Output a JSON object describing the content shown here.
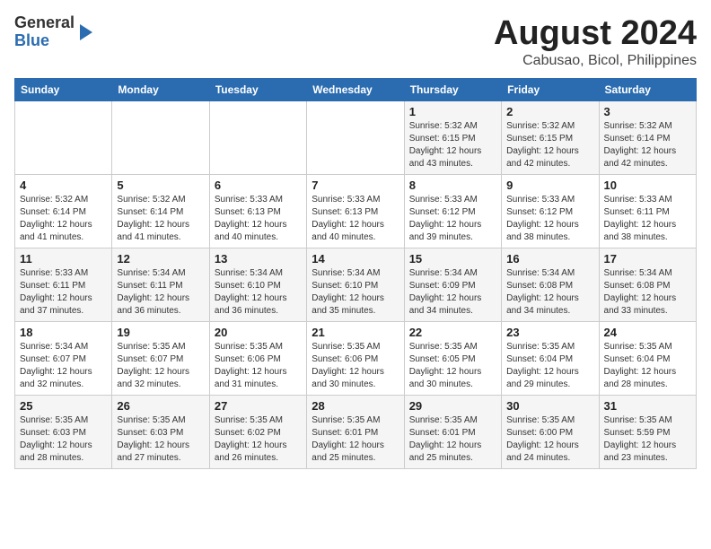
{
  "logo": {
    "general": "General",
    "blue": "Blue"
  },
  "title": "August 2024",
  "subtitle": "Cabusao, Bicol, Philippines",
  "days_of_week": [
    "Sunday",
    "Monday",
    "Tuesday",
    "Wednesday",
    "Thursday",
    "Friday",
    "Saturday"
  ],
  "weeks": [
    [
      {
        "day": "",
        "info": ""
      },
      {
        "day": "",
        "info": ""
      },
      {
        "day": "",
        "info": ""
      },
      {
        "day": "",
        "info": ""
      },
      {
        "day": "1",
        "info": "Sunrise: 5:32 AM\nSunset: 6:15 PM\nDaylight: 12 hours\nand 43 minutes."
      },
      {
        "day": "2",
        "info": "Sunrise: 5:32 AM\nSunset: 6:15 PM\nDaylight: 12 hours\nand 42 minutes."
      },
      {
        "day": "3",
        "info": "Sunrise: 5:32 AM\nSunset: 6:14 PM\nDaylight: 12 hours\nand 42 minutes."
      }
    ],
    [
      {
        "day": "4",
        "info": "Sunrise: 5:32 AM\nSunset: 6:14 PM\nDaylight: 12 hours\nand 41 minutes."
      },
      {
        "day": "5",
        "info": "Sunrise: 5:32 AM\nSunset: 6:14 PM\nDaylight: 12 hours\nand 41 minutes."
      },
      {
        "day": "6",
        "info": "Sunrise: 5:33 AM\nSunset: 6:13 PM\nDaylight: 12 hours\nand 40 minutes."
      },
      {
        "day": "7",
        "info": "Sunrise: 5:33 AM\nSunset: 6:13 PM\nDaylight: 12 hours\nand 40 minutes."
      },
      {
        "day": "8",
        "info": "Sunrise: 5:33 AM\nSunset: 6:12 PM\nDaylight: 12 hours\nand 39 minutes."
      },
      {
        "day": "9",
        "info": "Sunrise: 5:33 AM\nSunset: 6:12 PM\nDaylight: 12 hours\nand 38 minutes."
      },
      {
        "day": "10",
        "info": "Sunrise: 5:33 AM\nSunset: 6:11 PM\nDaylight: 12 hours\nand 38 minutes."
      }
    ],
    [
      {
        "day": "11",
        "info": "Sunrise: 5:33 AM\nSunset: 6:11 PM\nDaylight: 12 hours\nand 37 minutes."
      },
      {
        "day": "12",
        "info": "Sunrise: 5:34 AM\nSunset: 6:11 PM\nDaylight: 12 hours\nand 36 minutes."
      },
      {
        "day": "13",
        "info": "Sunrise: 5:34 AM\nSunset: 6:10 PM\nDaylight: 12 hours\nand 36 minutes."
      },
      {
        "day": "14",
        "info": "Sunrise: 5:34 AM\nSunset: 6:10 PM\nDaylight: 12 hours\nand 35 minutes."
      },
      {
        "day": "15",
        "info": "Sunrise: 5:34 AM\nSunset: 6:09 PM\nDaylight: 12 hours\nand 34 minutes."
      },
      {
        "day": "16",
        "info": "Sunrise: 5:34 AM\nSunset: 6:08 PM\nDaylight: 12 hours\nand 34 minutes."
      },
      {
        "day": "17",
        "info": "Sunrise: 5:34 AM\nSunset: 6:08 PM\nDaylight: 12 hours\nand 33 minutes."
      }
    ],
    [
      {
        "day": "18",
        "info": "Sunrise: 5:34 AM\nSunset: 6:07 PM\nDaylight: 12 hours\nand 32 minutes."
      },
      {
        "day": "19",
        "info": "Sunrise: 5:35 AM\nSunset: 6:07 PM\nDaylight: 12 hours\nand 32 minutes."
      },
      {
        "day": "20",
        "info": "Sunrise: 5:35 AM\nSunset: 6:06 PM\nDaylight: 12 hours\nand 31 minutes."
      },
      {
        "day": "21",
        "info": "Sunrise: 5:35 AM\nSunset: 6:06 PM\nDaylight: 12 hours\nand 30 minutes."
      },
      {
        "day": "22",
        "info": "Sunrise: 5:35 AM\nSunset: 6:05 PM\nDaylight: 12 hours\nand 30 minutes."
      },
      {
        "day": "23",
        "info": "Sunrise: 5:35 AM\nSunset: 6:04 PM\nDaylight: 12 hours\nand 29 minutes."
      },
      {
        "day": "24",
        "info": "Sunrise: 5:35 AM\nSunset: 6:04 PM\nDaylight: 12 hours\nand 28 minutes."
      }
    ],
    [
      {
        "day": "25",
        "info": "Sunrise: 5:35 AM\nSunset: 6:03 PM\nDaylight: 12 hours\nand 28 minutes."
      },
      {
        "day": "26",
        "info": "Sunrise: 5:35 AM\nSunset: 6:03 PM\nDaylight: 12 hours\nand 27 minutes."
      },
      {
        "day": "27",
        "info": "Sunrise: 5:35 AM\nSunset: 6:02 PM\nDaylight: 12 hours\nand 26 minutes."
      },
      {
        "day": "28",
        "info": "Sunrise: 5:35 AM\nSunset: 6:01 PM\nDaylight: 12 hours\nand 25 minutes."
      },
      {
        "day": "29",
        "info": "Sunrise: 5:35 AM\nSunset: 6:01 PM\nDaylight: 12 hours\nand 25 minutes."
      },
      {
        "day": "30",
        "info": "Sunrise: 5:35 AM\nSunset: 6:00 PM\nDaylight: 12 hours\nand 24 minutes."
      },
      {
        "day": "31",
        "info": "Sunrise: 5:35 AM\nSunset: 5:59 PM\nDaylight: 12 hours\nand 23 minutes."
      }
    ]
  ]
}
